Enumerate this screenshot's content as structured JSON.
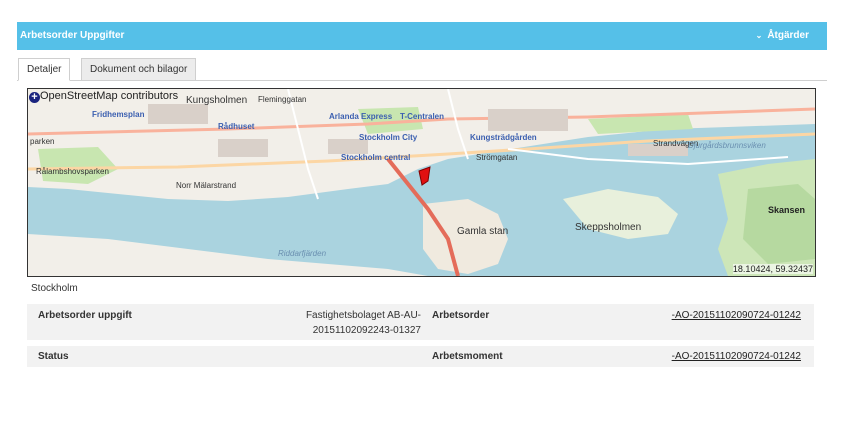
{
  "header": {
    "title": "Arbetsorder Uppgifter",
    "actions_label": "Åtgärder"
  },
  "tabs": [
    {
      "label": "Detaljer",
      "active": true
    },
    {
      "label": "Dokument och bilagor",
      "active": false
    }
  ],
  "map": {
    "attribution": "OpenStreetMap contributors",
    "zoom_button": "+",
    "coordinates": "18.10424, 59.32437",
    "labels": {
      "kungsholmen": "Kungsholmen",
      "fridhemsplan": "Fridhemsplan",
      "radhuset": "Rådhuset",
      "parken": "parken",
      "ralambshovsparken": "Rålambshovsparken",
      "norr_malarstrand": "Norr Mälarstrand",
      "arlanda_express": "Arlanda Express",
      "t_centralen": "T-Centralen",
      "stockholm_city": "Stockholm City",
      "stockholm_central": "Stockholm central",
      "kungstradgarden": "Kungsträdgården",
      "strandvagen": "Strandvägen",
      "skeppsholmen": "Skeppsholmen",
      "gamla_stan": "Gamla stan",
      "skansen": "Skansen",
      "djurgardsbrunnsviken": "Djurgårdsbrunnsviken",
      "riddarfjarden": "Riddarfjärden",
      "fleminggatan": "Fleminggatan",
      "strombron": "Strömgatan"
    }
  },
  "location": "Stockholm",
  "details": {
    "arbetsorder_uppgift_label": "Arbetsorder uppgift",
    "arbetsorder_uppgift_value_line1": "Fastighetsbolaget AB-AU-",
    "arbetsorder_uppgift_value_line2": "20151102092243-01327",
    "arbetsorder_label": "Arbetsorder",
    "arbetsorder_value": "-AO-20151102090724-01242",
    "status_label": "Status",
    "status_value": "",
    "arbetsmoment_label": "Arbetsmoment",
    "arbetsmoment_value": "-AO-20151102090724-01242"
  }
}
